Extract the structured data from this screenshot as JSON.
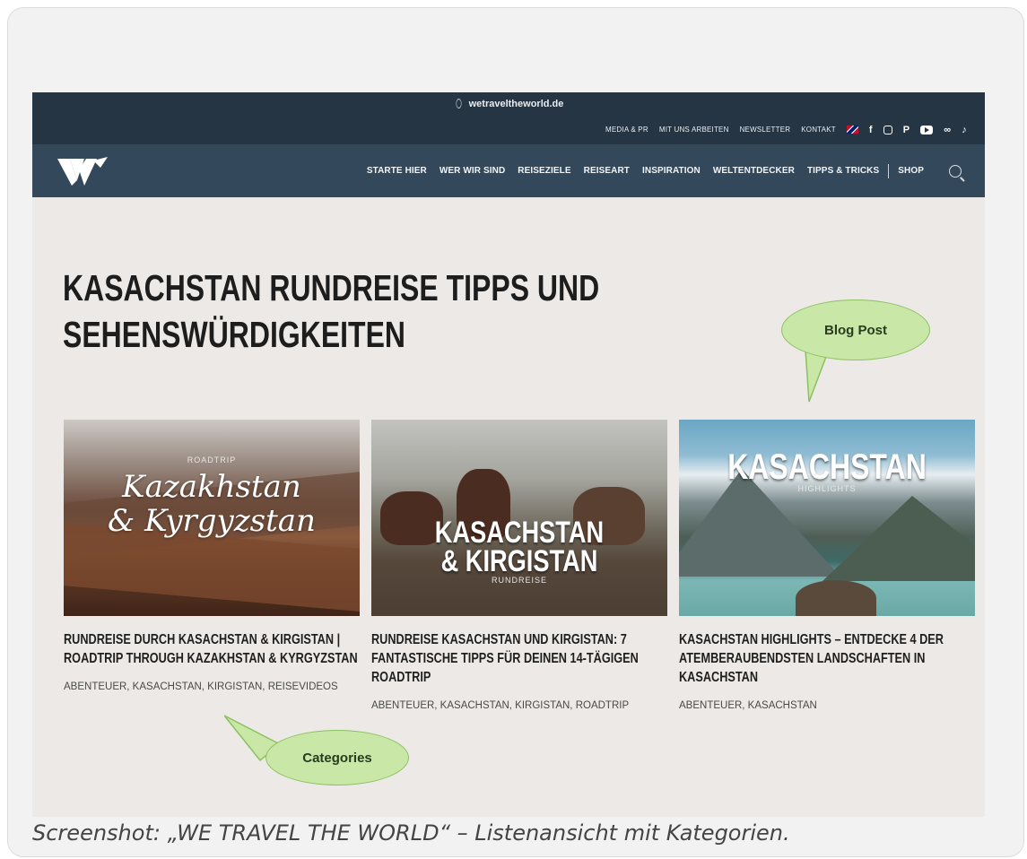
{
  "browser": {
    "url": "wetraveltheworld.de"
  },
  "utility_nav": {
    "items": [
      "MEDIA & PR",
      "MIT UNS ARBEITEN",
      "NEWSLETTER",
      "KONTAKT"
    ],
    "social_icons": [
      "facebook-icon",
      "instagram-icon",
      "pinterest-icon",
      "youtube-icon",
      "flickr-icon",
      "tiktok-icon"
    ],
    "fb": "f",
    "pin": "P",
    "flickr": "∞",
    "tiktok": "♪"
  },
  "main_nav": {
    "items": [
      "STARTE HIER",
      "WER WIR SIND",
      "REISEZIELE",
      "REISEART",
      "INSPIRATION",
      "WELTENTDECKER",
      "TIPPS & TRICKS"
    ],
    "shop": "SHOP"
  },
  "page": {
    "title_line1": "KASACHSTAN RUNDREISE TIPPS UND",
    "title_line2": "SEHENSWÜRDIGKEITEN"
  },
  "posts": [
    {
      "title": "RUNDREISE DURCH KASACHSTAN & KIRGISTAN | ROADTRIP THROUGH KAZAKHSTAN & KYRGYZSTAN",
      "categories": "ABENTEUER, KASACHSTAN, KIRGISTAN, REISEVIDEOS",
      "image_text": {
        "small": "ROADTRIP",
        "line1": "Kazakhstan",
        "line2": "& Kyrgyzstan"
      }
    },
    {
      "title": "RUNDREISE KASACHSTAN UND KIRGISTAN: 7 FANTASTISCHE TIPPS FÜR DEINEN 14-TÄGIGEN ROADTRIP",
      "categories": "ABENTEUER, KASACHSTAN, KIRGISTAN, ROADTRIP",
      "image_text": {
        "line1": "KASACHSTAN",
        "line2": "& KIRGISTAN",
        "small": "RUNDREISE"
      }
    },
    {
      "title": "KASACHSTAN HIGHLIGHTS – ENTDECKE 4 DER ATEMBERAUBENDSTEN LANDSCHAFTEN IN KASACHSTAN",
      "categories": "ABENTEUER, KASACHSTAN",
      "image_text": {
        "line1": "KASACHSTAN",
        "small": "HIGHLIGHTS"
      }
    }
  ],
  "annotations": {
    "blog_post": "Blog Post",
    "categories": "Categories"
  },
  "caption": "Screenshot: „WE TRAVEL THE WORLD“ – Listenansicht mit Kategorien.",
  "colors": {
    "topbar": "#253544",
    "navbar": "#34485c",
    "page_bg": "#ece9e6",
    "bubble_fill": "#c9e7a6",
    "bubble_border": "#8cc160"
  }
}
